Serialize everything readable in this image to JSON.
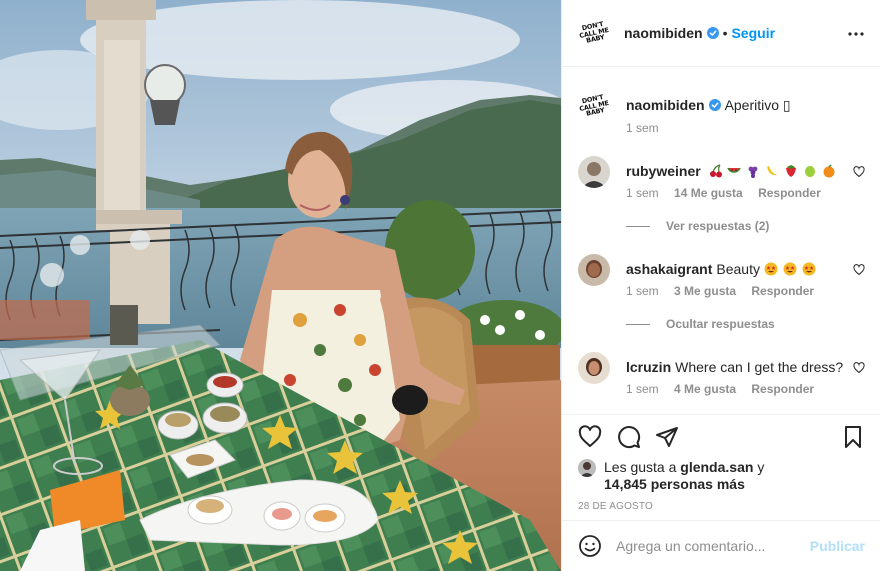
{
  "post": {
    "username": "naomibiden",
    "follow_label": "Seguir",
    "logo_text": "DON'T CALL ME BABY"
  },
  "caption": {
    "username": "naomibiden",
    "text": "Aperitivo ",
    "glyph": "▯",
    "age": "1 sem"
  },
  "comments": [
    {
      "username": "rubyweiner",
      "text": "",
      "emojis": [
        "cherries",
        "watermelon",
        "grapes",
        "banana",
        "strawberry",
        "lime",
        "orange"
      ],
      "age": "1 sem",
      "likes": "14 Me gusta",
      "reply": "Responder",
      "thread": "Ver respuestas (2)"
    },
    {
      "username": "ashakaigrant",
      "text": "Beauty",
      "emojis": [
        "star-struck",
        "star-struck",
        "star-struck"
      ],
      "age": "1 sem",
      "likes": "3 Me gusta",
      "reply": "Responder",
      "thread": "Ocultar respuestas"
    },
    {
      "username": "lcruzin",
      "text": "Where can I get the dress?",
      "emojis": [],
      "age": "1 sem",
      "likes": "4 Me gusta",
      "reply": "Responder"
    }
  ],
  "likes_line": {
    "prefix": "Les gusta a",
    "user": "glenda.san",
    "joiner": "y",
    "count": "14,845 personas más"
  },
  "date": "28 DE AGOSTO",
  "composer": {
    "placeholder": "Agrega un comentario...",
    "publish_label": "Publicar"
  },
  "icons": {
    "more": "more-horizontal-icon",
    "like": "heart-icon",
    "comment": "comment-icon",
    "share": "paper-plane-icon",
    "save": "bookmark-icon",
    "emoji": "smiley-icon",
    "verified": "verified-badge-icon"
  },
  "colors": {
    "accent": "#0095f6",
    "verified": "#3897f0",
    "muted": "#8e8e8e",
    "publish_disabled": "#b2dffc"
  }
}
